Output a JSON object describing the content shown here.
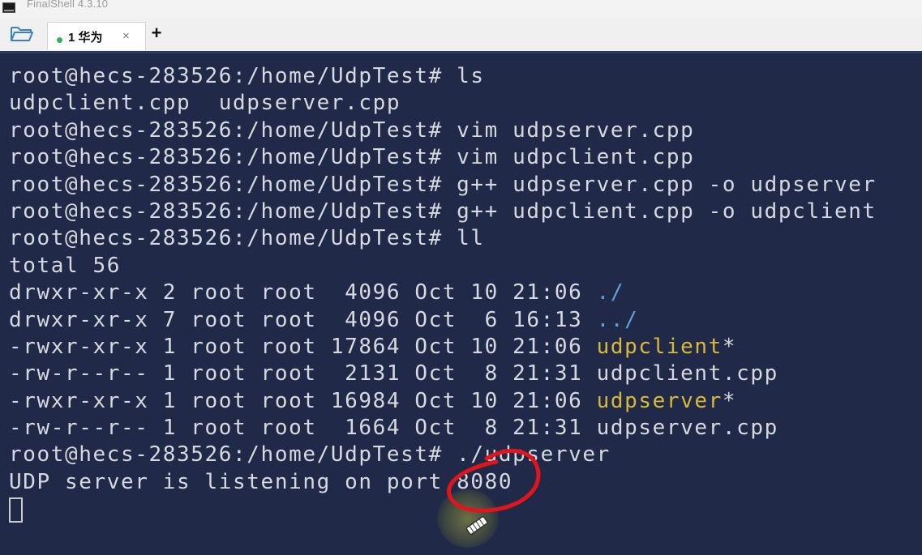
{
  "window": {
    "title": "FinalShell 4.3.10"
  },
  "tabbar": {
    "folder_icon": "folder-open-icon",
    "tab": {
      "label": "1 华为",
      "status_color": "#2fb35a",
      "close_glyph": "×"
    },
    "add_glyph": "+"
  },
  "terminal": {
    "background": "#202a48",
    "lines": [
      {
        "parts": [
          {
            "text": "root@hecs-283526:/home/UdpTest# ls"
          }
        ]
      },
      {
        "parts": [
          {
            "text": "udpclient.cpp  udpserver.cpp"
          }
        ]
      },
      {
        "parts": [
          {
            "text": "root@hecs-283526:/home/UdpTest# vim udpserver.cpp"
          }
        ]
      },
      {
        "parts": [
          {
            "text": "root@hecs-283526:/home/UdpTest# vim udpclient.cpp"
          }
        ]
      },
      {
        "parts": [
          {
            "text": "root@hecs-283526:/home/UdpTest# g++ udpserver.cpp -o udpserver"
          }
        ]
      },
      {
        "parts": [
          {
            "text": "root@hecs-283526:/home/UdpTest# g++ udpclient.cpp -o udpclient"
          }
        ]
      },
      {
        "parts": [
          {
            "text": "root@hecs-283526:/home/UdpTest# ll"
          }
        ]
      },
      {
        "parts": [
          {
            "text": "total 56"
          }
        ]
      },
      {
        "parts": [
          {
            "text": "drwxr-xr-x 2 root root  4096 Oct 10 21:06 "
          },
          {
            "text": "./",
            "color": "cyan"
          }
        ]
      },
      {
        "parts": [
          {
            "text": "drwxr-xr-x 7 root root  4096 Oct  6 16:13 "
          },
          {
            "text": "../",
            "color": "cyan"
          }
        ]
      },
      {
        "parts": [
          {
            "text": "-rwxr-xr-x 1 root root 17864 Oct 10 21:06 "
          },
          {
            "text": "udpclient",
            "color": "yellow"
          },
          {
            "text": "*"
          }
        ]
      },
      {
        "parts": [
          {
            "text": "-rw-r--r-- 1 root root  2131 Oct  8 21:31 udpclient.cpp"
          }
        ]
      },
      {
        "parts": [
          {
            "text": "-rwxr-xr-x 1 root root 16984 Oct 10 21:06 "
          },
          {
            "text": "udpserver",
            "color": "yellow"
          },
          {
            "text": "*"
          }
        ]
      },
      {
        "parts": [
          {
            "text": "-rw-r--r-- 1 root root  1664 Oct  8 21:31 udpserver.cpp"
          }
        ]
      },
      {
        "parts": [
          {
            "text": "root@hecs-283526:/home/UdpTest# ./udpserver"
          }
        ]
      },
      {
        "parts": [
          {
            "text": "UDP server is listening on port 8080"
          }
        ]
      }
    ],
    "colors": {
      "default": "#d6d9df",
      "cyan": "#5aa2d8",
      "yellow": "#d7b93a"
    },
    "annotation_color": "#e0151b"
  }
}
